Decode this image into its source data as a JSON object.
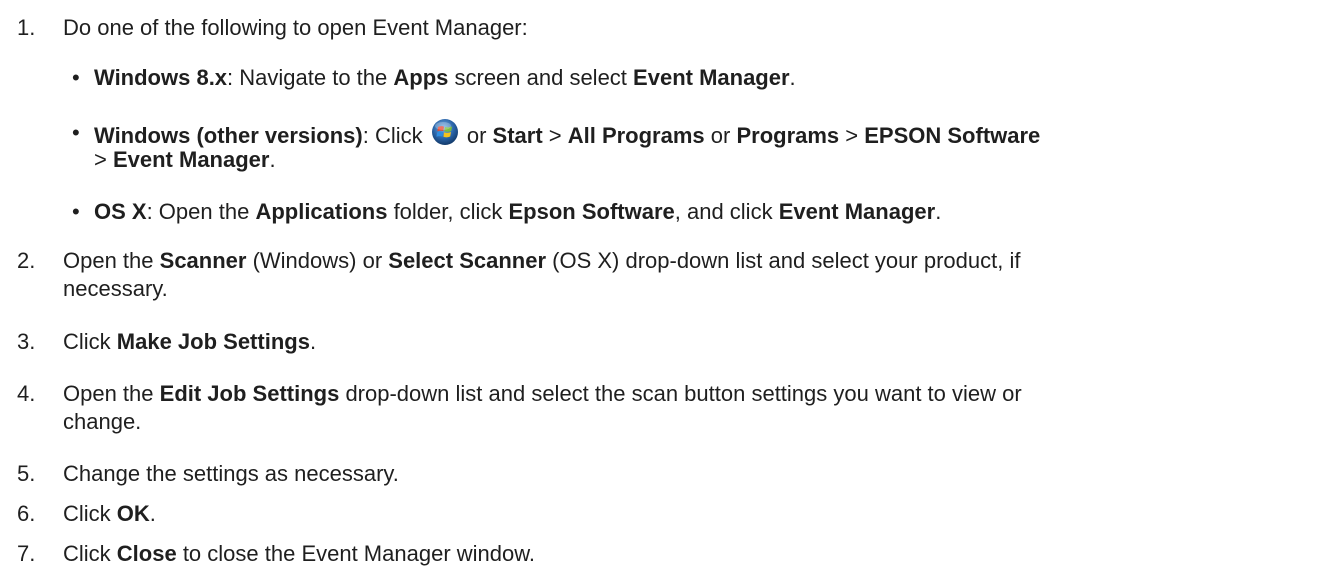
{
  "steps": [
    {
      "number": "1.",
      "intro": "Do one of the following to open Event Manager:",
      "options": [
        {
          "bullet": "•",
          "b1": "Windows 8.x",
          "t1": ": Navigate to the ",
          "b2": "Apps",
          "t2": " screen and select ",
          "b3": "Event Manager",
          "t3": "."
        },
        {
          "bullet": "•",
          "b1": "Windows (other versions)",
          "t1": ": Click ",
          "icon": "windows-start-orb-icon",
          "t2": " or ",
          "b2": "Start",
          "t3": " > ",
          "b3": "All Programs",
          "t4": " or ",
          "b4": "Programs",
          "t5": " > ",
          "b5": "EPSON Software",
          "t6": "> ",
          "b6": "Event Manager",
          "t7": "."
        },
        {
          "bullet": "•",
          "b1": "OS X",
          "t1": ": Open the ",
          "b2": "Applications",
          "t2": " folder, click ",
          "b3": "Epson Software",
          "t3": ", and click ",
          "b4": "Event Manager",
          "t4": "."
        }
      ]
    },
    {
      "number": "2.",
      "t1": "Open the ",
      "b1": "Scanner",
      "t2": " (Windows) or ",
      "b2": "Select Scanner",
      "t3": " (OS X) drop-down list and select your product, if",
      "t4": "necessary."
    },
    {
      "number": "3.",
      "t1": "Click ",
      "b1": "Make Job Settings",
      "t2": "."
    },
    {
      "number": "4.",
      "t1": "Open the ",
      "b1": "Edit Job Settings",
      "t2": " drop-down list and select the scan button settings you want to view or",
      "t3": "change."
    },
    {
      "number": "5.",
      "t1": "Change the settings as necessary."
    },
    {
      "number": "6.",
      "t1": "Click ",
      "b1": "OK",
      "t2": "."
    },
    {
      "number": "7.",
      "t1": "Click ",
      "b1": "Close",
      "t2": " to close the Event Manager window."
    }
  ]
}
